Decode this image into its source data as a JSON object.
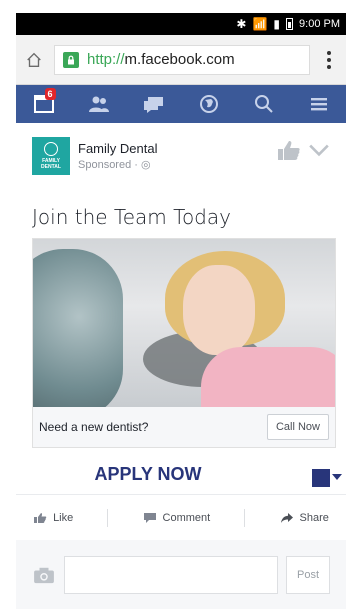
{
  "status_bar": {
    "time": "9:00 PM"
  },
  "browser": {
    "url_protocol": "http://",
    "url_host": "m.facebook.com"
  },
  "nav": {
    "notification_count": "6"
  },
  "post": {
    "page_name": "Family Dental",
    "sponsored_label": "Sponsored · ",
    "logo_text": "FAMILY\nDENTAL",
    "headline": "Join the Team Today",
    "ad_question": "Need a new dentist?",
    "cta_label": "Call Now",
    "apply_text": "APPLY NOW"
  },
  "actions": {
    "like": "Like",
    "comment": "Comment",
    "share": "Share"
  },
  "comment": {
    "post_label": "Post"
  },
  "colors": {
    "facebook_blue": "#3b5998",
    "apply_navy": "#28357a",
    "logo_teal": "#1fa6a1",
    "badge_red": "#e0262b"
  }
}
